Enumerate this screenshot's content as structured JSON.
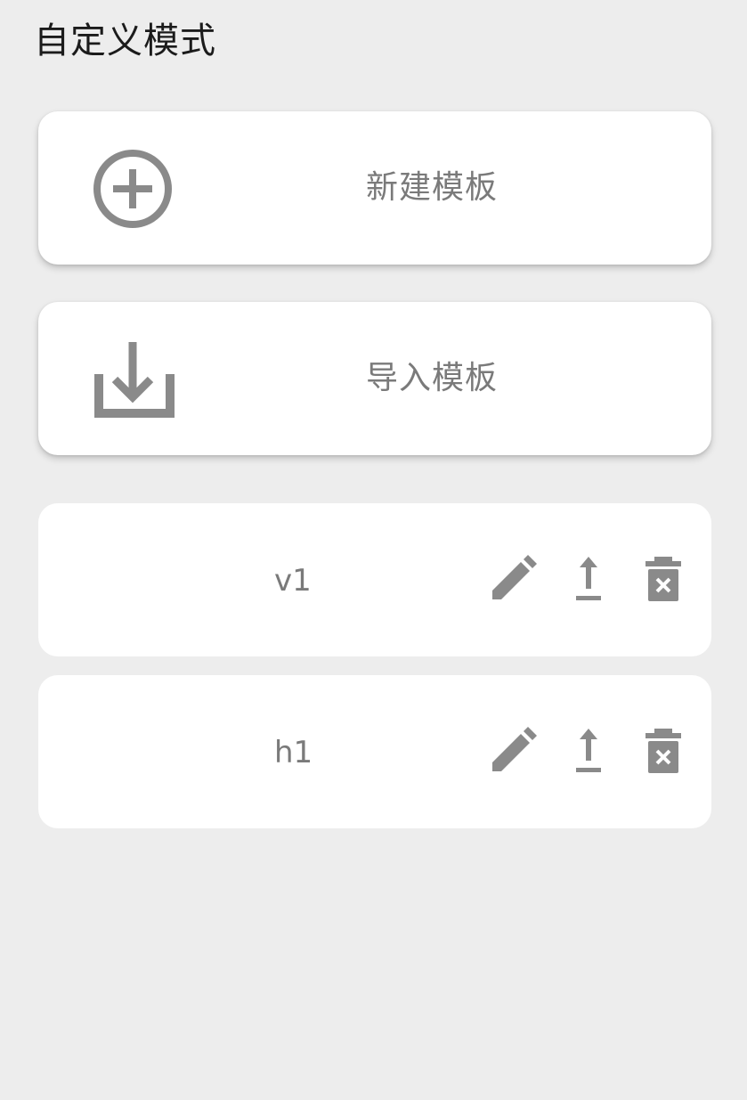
{
  "page": {
    "title": "自定义模式"
  },
  "actions": [
    {
      "label": "新建模板",
      "icon": "add-circle-icon"
    },
    {
      "label": "导入模板",
      "icon": "download-tray-icon"
    }
  ],
  "templates": [
    {
      "name": "v1",
      "tools": [
        "edit-icon",
        "upload-icon",
        "delete-icon"
      ]
    },
    {
      "name": "h1",
      "tools": [
        "edit-icon",
        "upload-icon",
        "delete-icon"
      ]
    }
  ],
  "colors": {
    "background": "#ededed",
    "card": "#ffffff",
    "icon": "#8a8a8a",
    "text_muted": "#7a7a7a"
  }
}
